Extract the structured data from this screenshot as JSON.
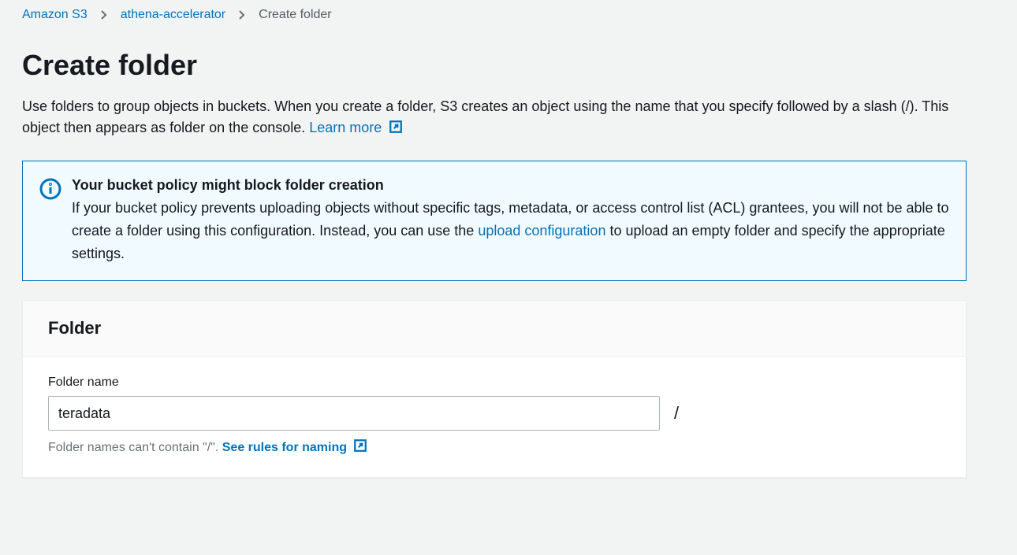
{
  "breadcrumb": {
    "items": [
      {
        "label": "Amazon S3",
        "href": "#"
      },
      {
        "label": "athena-accelerator",
        "href": "#"
      }
    ],
    "current": "Create folder"
  },
  "page": {
    "title": "Create folder",
    "description_pre": "Use folders to group objects in buckets. When you create a folder, S3 creates an object using the name that you specify followed by a slash (/). This object then appears as folder on the console. ",
    "learn_more": "Learn more"
  },
  "info_box": {
    "title": "Your bucket policy might block folder creation",
    "body_pre": "If your bucket policy prevents uploading objects without specific tags, metadata, or access control list (ACL) grantees, you will not be able to create a folder using this configuration. Instead, you can use the ",
    "body_link": "upload configuration",
    "body_post": " to upload an empty folder and specify the appropriate settings."
  },
  "folder_panel": {
    "heading": "Folder",
    "name_label": "Folder name",
    "name_value": "teradata",
    "slash": "/",
    "hint_pre": "Folder names can't contain \"/\". ",
    "hint_link": "See rules for naming"
  }
}
